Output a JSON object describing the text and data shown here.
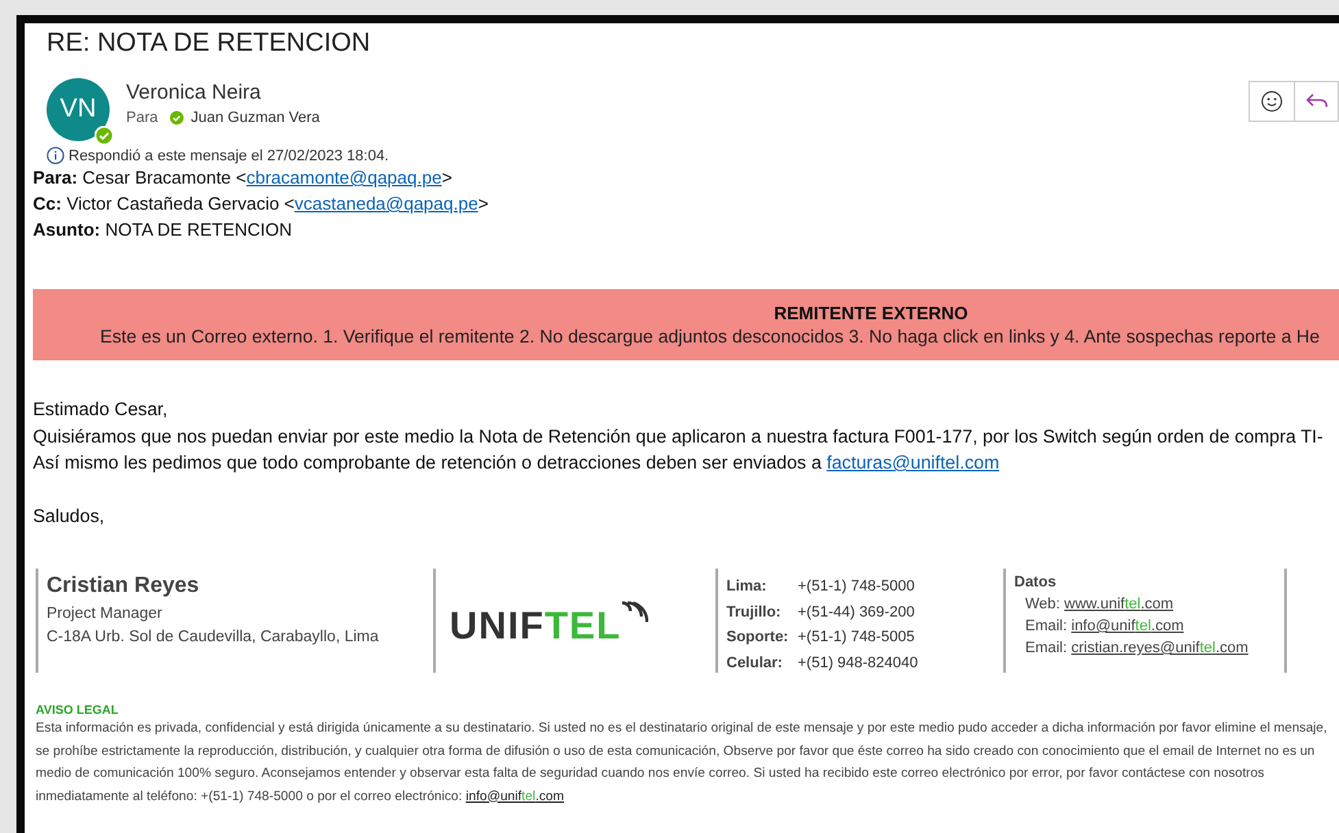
{
  "message": {
    "subject": "RE: NOTA DE RETENCION",
    "sender": {
      "initials": "VN",
      "name": "Veronica Neira"
    },
    "to_label": "Para",
    "recipient": "Juan Guzman Vera",
    "info": "Respondió a este mensaje el 27/02/2023 18:04."
  },
  "quoted_header": [
    {
      "label": "Para:",
      "text": "Cesar Bracamonte <",
      "link": "cbracamonte@qapaq.pe",
      "after": ">"
    },
    {
      "label": "Cc:",
      "text": "Victor Castañeda Gervacio <",
      "link": "vcastaneda@qapaq.pe",
      "after": ">"
    },
    {
      "label": "Asunto:",
      "text": "NOTA DE RETENCION"
    }
  ],
  "banner": {
    "title": "REMITENTE EXTERNO",
    "text": "Este es un Correo externo. 1. Verifique el remitente 2. No descargue adjuntos desconocidos 3. No haga click en links y 4. Ante sospechas reporte a He"
  },
  "body": {
    "greeting": "Estimado Cesar,",
    "line_1": "Quisiéramos que nos puedan enviar por este medio la Nota de Retención que aplicaron a nuestra factura F001-177, por los Switch según orden de compra TI-",
    "line_2": "Así mismo les pedimos que todo comprobante de retención o detracciones deben ser enviados a",
    "line_2_link": "facturas@uniftel.com",
    "closing": "Saludos,"
  },
  "signature": {
    "name": "Cristian Reyes",
    "role": "Project Manager",
    "address": "C-18A Urb. Sol de Caudevilla, Carabayllo, Lima",
    "logo": [
      {
        "text": "UNIF",
        "accent": false
      },
      {
        "text": "TEL",
        "accent": true
      }
    ],
    "phones": [
      {
        "label": "Lima:",
        "value": "+(51-1) 748-5000"
      },
      {
        "label": "Trujillo:",
        "value": "+(51-44) 369-200"
      },
      {
        "label": "Soporte:",
        "value": "+(51-1) 748-5005"
      },
      {
        "label": "Celular:",
        "value": "+(51) 948-824040"
      }
    ],
    "data_title": "Datos",
    "data": [
      {
        "label": "Web:",
        "parts": [
          {
            "text": "www.unif",
            "accent": false
          },
          {
            "text": "tel",
            "accent": true
          },
          {
            "text": ".com",
            "accent": false
          }
        ]
      },
      {
        "label": "Email:",
        "parts": [
          {
            "text": "info@unif",
            "accent": false
          },
          {
            "text": "tel",
            "accent": true
          },
          {
            "text": ".com",
            "accent": false
          }
        ]
      },
      {
        "label": "Email:",
        "parts": [
          {
            "text": "cristian.reyes@unif",
            "accent": false
          },
          {
            "text": "tel",
            "accent": true
          },
          {
            "text": ".com",
            "accent": false
          }
        ]
      }
    ]
  },
  "legal": {
    "title": "AVISO LEGAL",
    "text": "Esta información es privada, confidencial y está dirigida únicamente a su destinatario. Si usted no es el destinatario original de este mensaje y por este medio pudo acceder a dicha información por favor elimine el mensaje, se prohíbe estrictamente la reproducción, distribución, y cualquier otra forma de difusión o uso de esta comunicación, Observe por favor que éste correo ha sido creado con conocimiento que el email de Internet no es un medio de comunicación 100% seguro. Aconsejamos entender y observar esta falta de seguridad cuando nos envíe correo. Si usted ha recibido este correo electrónico por error, por favor contáctese con nosotros inmediatamente al teléfono: +(51-1) 748-5000 o por el correo electrónico:",
    "link": [
      {
        "text": "info@unif",
        "accent": false
      },
      {
        "text": "tel",
        "accent": true
      },
      {
        "text": ".com",
        "accent": false
      }
    ]
  }
}
